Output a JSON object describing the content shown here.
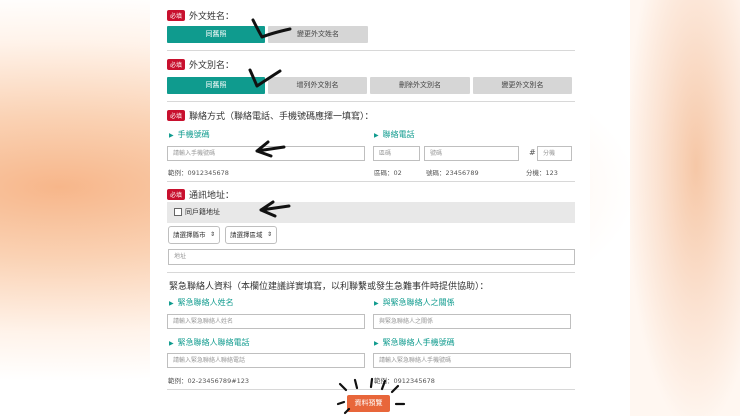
{
  "required_tag": "必填",
  "foreign_name": {
    "title": "外文姓名：",
    "buttons": [
      "同舊照",
      "變更外文姓名"
    ]
  },
  "foreign_alias": {
    "title": "外文別名：",
    "buttons": [
      "同舊照",
      "增列外文別名",
      "刪除外文別名",
      "變更外文別名"
    ]
  },
  "contact": {
    "title": "聯絡方式（聯絡電話、手機號碼應擇一填寫）：",
    "mobile_label": "手機號碼",
    "mobile_placeholder": "請輸入手機號碼",
    "mobile_hint": "範例：0912345678",
    "phone_label": "聯絡電話",
    "area_placeholder": "區碼",
    "number_placeholder": "號碼",
    "ext_symbol": "#",
    "ext_placeholder": "分機",
    "area_hint": "區碼：02",
    "number_hint": "號碼：23456789",
    "ext_hint": "分機：123"
  },
  "address": {
    "title": "通訊地址：",
    "same_as_household": "同戶籍地址",
    "city_select": "請選擇縣市",
    "district_select": "請選擇區域",
    "address_placeholder": "地址"
  },
  "emergency": {
    "title": "緊急聯絡人資料（本欄位建議詳實填寫，以利聯繫或發生急難事件時提供協助）：",
    "name_label": "緊急聯絡人姓名",
    "name_placeholder": "請輸入緊急聯絡人姓名",
    "relation_label": "與緊急聯絡人之關係",
    "relation_placeholder": "與緊急聯絡人之關係",
    "phone_label": "緊急聯絡人聯絡電話",
    "phone_placeholder": "請輸入緊急聯絡人聯絡電話",
    "phone_hint": "範例：02-23456789#123",
    "mobile_label": "緊急聯絡人手機號碼",
    "mobile_placeholder": "請輸入緊急聯絡人手機號碼",
    "mobile_hint": "範例：0912345678"
  },
  "preview_button": "資料預覽",
  "colors": {
    "primary": "#0f9b8e",
    "required": "#c8102e",
    "preview": "#e8663a"
  }
}
